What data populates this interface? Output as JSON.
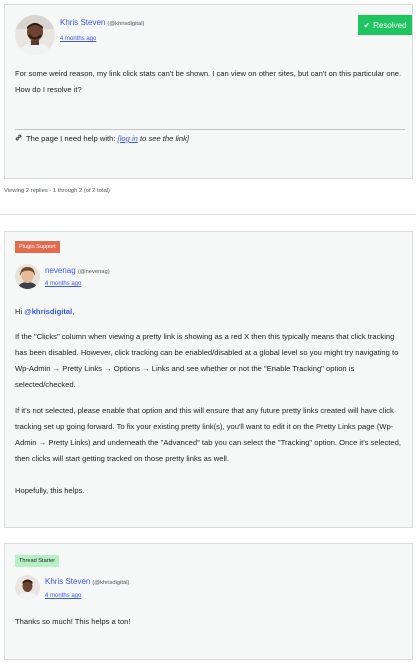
{
  "topic": {
    "author_name": "Khris Steven",
    "author_handle": "(@khrisdigital)",
    "date": "4 months ago",
    "status": "Resolved",
    "body": "For some weird reason, my link click stats can't be shown. I can view on other sites, but can't on this particular one. How do I resolve it?",
    "help_prefix": "The page I need help with:",
    "help_link": "[log in",
    "help_suffix": "to see the link]"
  },
  "viewing_text": "Viewing 2 replies - 1 through 2 (of 2 total)",
  "replies": [
    {
      "badge": "Plugin Support",
      "author_name": "nevenag",
      "author_handle": "(@nevenag)",
      "date": "4 months ago",
      "greeting_prefix": "Hi",
      "mention": "@khrisdigital",
      "greeting_suffix": ",",
      "p1": "If the \"Clicks\" column when viewing a pretty link is showing as a red X then this typically means that click tracking has been disabled. However, click tracking can be enabled/disabled at a global level so you might try navigating to Wp-Admin → Pretty Links → Options → Links and see whether or not the \"Enable Tracking\" option is selected/checked.",
      "p2": "If it's not selected, please enable that option and this will ensure that any future pretty links created will have click tracking set up going forward. To fix your existing pretty link(s), you'll want to edit it on the Pretty Links page (Wp-Admin → Pretty Links) and underneath the \"Advanced\" tab you can select the \"Tracking\" option. Once it's selected, then clicks will start getting tracked on those pretty links as well.",
      "p3": "Hopefully, this helps."
    },
    {
      "badge": "Thread Starter",
      "author_name": "Khris Steven",
      "author_handle": "(@khrisdigital)",
      "date": "4 months ago",
      "body": "Thanks so much! This helps a ton!"
    }
  ],
  "colors": {
    "accent": "#3858e9",
    "resolved": "#1fc55e",
    "plugin_support": "#e26a4e",
    "thread_starter": "#b8f0c6"
  }
}
